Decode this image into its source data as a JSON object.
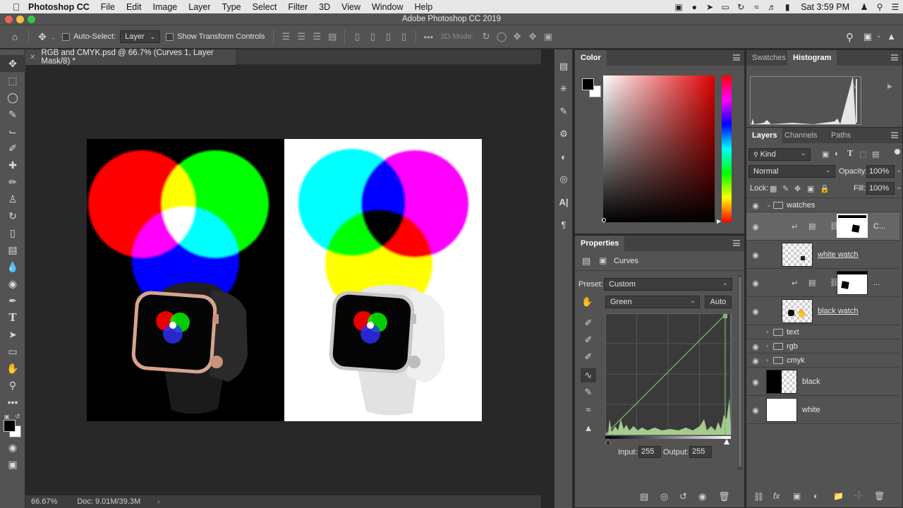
{
  "menubar": {
    "app_name": "Photoshop CC",
    "items": [
      "File",
      "Edit",
      "Image",
      "Layer",
      "Type",
      "Select",
      "Filter",
      "3D",
      "View",
      "Window",
      "Help"
    ],
    "clock": "Sat 3:59 PM"
  },
  "window": {
    "title": "Adobe Photoshop CC 2019"
  },
  "options_bar": {
    "auto_select_label": "Auto-Select:",
    "auto_select_value": "Layer",
    "transform_label": "Show Transform Controls",
    "mode_label": "3D Mode:"
  },
  "document": {
    "tab_title": "RGB and CMYK.psd @ 66.7% (Curves 1, Layer Mask/8) *",
    "zoom": "66.67%",
    "doc_info": "Doc: 9.01M/39.3M"
  },
  "color_panel": {
    "tab": "Color"
  },
  "swatches_panel": {
    "tabs": [
      "Swatches",
      "Histogram"
    ],
    "active": 1
  },
  "properties_panel": {
    "tab": "Properties",
    "adjustment": "Curves",
    "preset_label": "Preset:",
    "preset_value": "Custom",
    "channel_value": "Green",
    "auto_label": "Auto",
    "input_label": "Input:",
    "input_value": "255",
    "output_label": "Output:",
    "output_value": "255"
  },
  "layers_panel": {
    "tabs": [
      "Layers",
      "Channels",
      "Paths"
    ],
    "filter_value": "Kind",
    "blend_mode": "Normal",
    "opacity_label": "Opacity:",
    "opacity_value": "100%",
    "lock_label": "Lock:",
    "fill_label": "Fill:",
    "fill_value": "100%",
    "layers": [
      {
        "name": "watches",
        "kind": "group"
      },
      {
        "name": "C...",
        "kind": "adjustment"
      },
      {
        "name": "white watch",
        "kind": "pixel"
      },
      {
        "name": "...",
        "kind": "adjustment"
      },
      {
        "name": "black watch",
        "kind": "pixel"
      },
      {
        "name": "text",
        "kind": "group"
      },
      {
        "name": "rgb",
        "kind": "group"
      },
      {
        "name": "cmyk",
        "kind": "group"
      },
      {
        "name": "black",
        "kind": "pixel"
      },
      {
        "name": "white",
        "kind": "pixel"
      }
    ]
  },
  "colors": {
    "ui_panel": "#535353",
    "ui_dark": "#282828",
    "accent_curve": "#7ac06a"
  }
}
